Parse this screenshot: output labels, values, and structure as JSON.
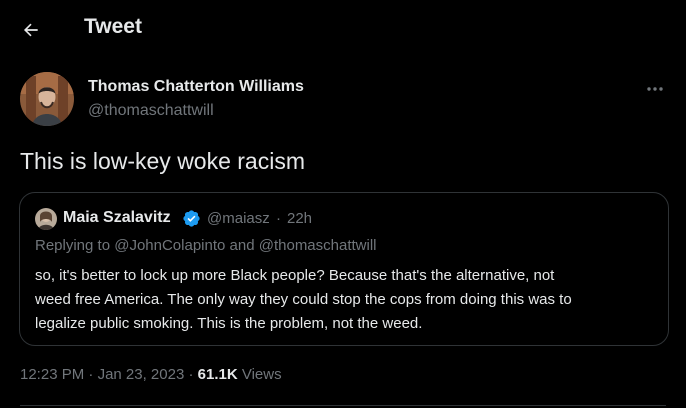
{
  "header": {
    "title": "Tweet"
  },
  "tweet": {
    "author_name": "Thomas Chatterton Williams",
    "author_handle": "@thomaschattwill",
    "text": "This is low-key woke racism",
    "time": "12:23 PM",
    "date": "Jan 23, 2023",
    "views_count": "61.1K",
    "views_label": "Views"
  },
  "quote": {
    "name": "Maia Szalavitz",
    "handle": "@maiasz",
    "separator": "·",
    "time": "22h",
    "replying_prefix": "Replying to",
    "replying_user1": "@JohnColapinto",
    "replying_and": "and",
    "replying_user2": "@thomaschattwill",
    "lines": [
      "so, it's better to lock up more Black people?  Because that's the alternative, not",
      "weed free America. The only way they could stop the cops from doing this was to",
      "legalize public smoking.  This is the problem, not the weed."
    ]
  },
  "meta_separator": "·",
  "colors": {
    "background": "#000000",
    "text": "#e7e9ea",
    "secondary": "#71767b",
    "verified": "#1d9bf0",
    "border": "#2f3336"
  },
  "icons": {
    "back": "arrow-left-icon",
    "more": "more-horizontal-icon",
    "verified": "verified-badge-icon"
  }
}
